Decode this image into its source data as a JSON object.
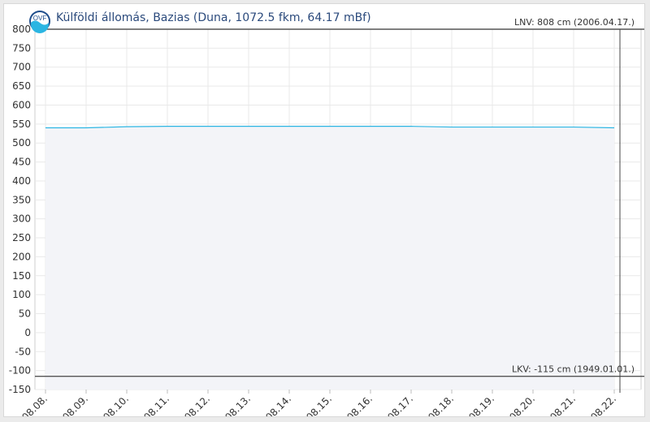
{
  "header": {
    "title": "Külföldi állomás, Bazias (Duna, 1072.5 fkm, 64.17 mBf)",
    "logo_text": "OVF",
    "logo_icon": "wave-logo-icon"
  },
  "colors": {
    "series": "#2bb5e2",
    "fill": "#f3f4f8",
    "grid": "#e9e9e9",
    "reference": "#555555",
    "title": "#2b4a7c"
  },
  "chart_data": {
    "type": "area",
    "title": "Külföldi állomás, Bazias (Duna, 1072.5 fkm, 64.17 mBf)",
    "xlabel": "",
    "ylabel": "",
    "ylim": [
      -150,
      800
    ],
    "y_ticks": [
      800,
      750,
      700,
      650,
      600,
      550,
      500,
      450,
      400,
      350,
      300,
      250,
      200,
      150,
      100,
      50,
      0,
      -50,
      -100,
      -150
    ],
    "xlim": [
      "08.08.",
      "08.22."
    ],
    "x_ticks": [
      "08.08.",
      "08.09.",
      "08.10.",
      "08.11.",
      "08.12.",
      "08.13.",
      "08.14.",
      "08.15.",
      "08.16.",
      "08.17.",
      "08.18.",
      "08.19.",
      "08.20.",
      "08.21.",
      "08.22."
    ],
    "grid": true,
    "series": [
      {
        "x": [
          "08.08.",
          "08.09.",
          "08.10.",
          "08.11.",
          "08.12.",
          "08.13.",
          "08.14.",
          "08.15.",
          "08.16.",
          "08.17.",
          "08.18.",
          "08.19.",
          "08.20.",
          "08.21.",
          "08.22."
        ],
        "values": [
          540,
          540,
          543,
          544,
          544,
          544,
          544,
          544,
          544,
          544,
          542,
          542,
          542,
          542,
          540
        ]
      }
    ],
    "reference_lines": [
      {
        "label": "LNV: 808 cm (2006.04.17.)",
        "value": 808
      },
      {
        "label": "LKV: -115 cm (1949.01.01.)",
        "value": -115
      }
    ],
    "now_marker": "08.22."
  }
}
